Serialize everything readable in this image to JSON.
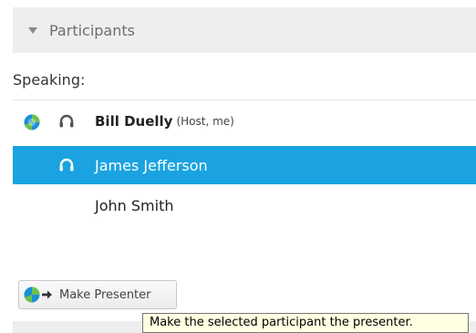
{
  "panel": {
    "title": "Participants",
    "speaking_label": "Speaking:"
  },
  "participants": [
    {
      "name": "Bill Duelly",
      "tag": "(Host, me)",
      "is_presenter": true,
      "audio_icon": "headset-icon",
      "selected": false
    },
    {
      "name": "James Jefferson",
      "tag": "",
      "is_presenter": false,
      "audio_icon": "headset-icon",
      "selected": true
    },
    {
      "name": "John Smith",
      "tag": "",
      "is_presenter": false,
      "audio_icon": "",
      "selected": false
    }
  ],
  "toolbar": {
    "make_presenter_label": "Make Presenter",
    "make_presenter_icon": "presenter-arrow-icon"
  },
  "tooltip": {
    "text": "Make the selected participant the presenter."
  },
  "colors": {
    "selection": "#1aa3e0",
    "header_bg": "#eeeeee",
    "tooltip_bg": "#ffffe1",
    "presenter_ball_blue": "#1c8fd6",
    "presenter_ball_green": "#6cc04a",
    "icon_gray": "#555555"
  }
}
